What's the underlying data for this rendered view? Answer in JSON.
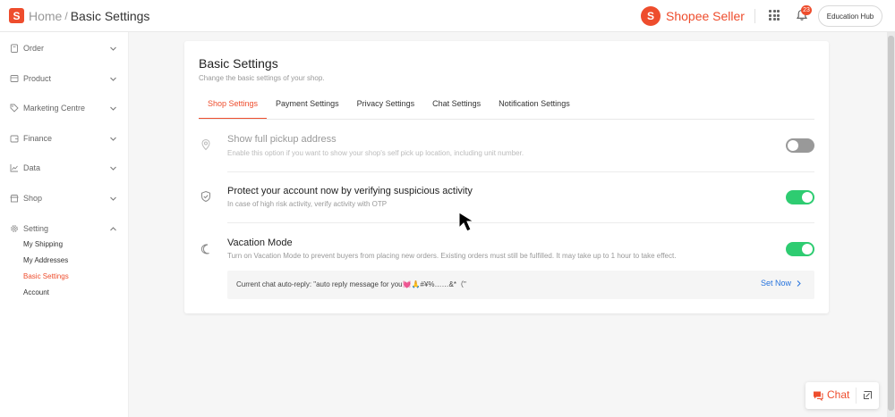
{
  "header": {
    "logo_letter": "S",
    "breadcrumb_home": "Home",
    "breadcrumb_sep": "/",
    "breadcrumb_current": "Basic Settings",
    "brand_name": "Shopee Seller",
    "notification_count": "23",
    "education_hub": "Education Hub"
  },
  "sidebar": {
    "items": [
      {
        "label": "Order",
        "icon": "clipboard-icon"
      },
      {
        "label": "Product",
        "icon": "box-icon"
      },
      {
        "label": "Marketing Centre",
        "icon": "tag-icon"
      },
      {
        "label": "Finance",
        "icon": "wallet-icon"
      },
      {
        "label": "Data",
        "icon": "chart-icon"
      },
      {
        "label": "Shop",
        "icon": "store-icon"
      },
      {
        "label": "Setting",
        "icon": "gear-icon"
      }
    ],
    "sub_items": [
      {
        "label": "My Shipping",
        "active": false
      },
      {
        "label": "My Addresses",
        "active": false
      },
      {
        "label": "Basic Settings",
        "active": true
      },
      {
        "label": "Account",
        "active": false
      }
    ]
  },
  "main": {
    "title": "Basic Settings",
    "subtitle": "Change the basic settings of your shop.",
    "tabs": [
      {
        "label": "Shop Settings",
        "active": true
      },
      {
        "label": "Payment Settings",
        "active": false
      },
      {
        "label": "Privacy Settings",
        "active": false
      },
      {
        "label": "Chat Settings",
        "active": false
      },
      {
        "label": "Notification Settings",
        "active": false
      }
    ],
    "settings": [
      {
        "title": "Show full pickup address",
        "description": "Enable this option if you want to show your shop's self pick up location, including unit number.",
        "enabled": false,
        "disabled": true,
        "icon": "location-pin-icon"
      },
      {
        "title": "Protect your account now by verifying suspicious activity",
        "description": "In case of high risk activity, verify activity with OTP",
        "enabled": true,
        "disabled": false,
        "icon": "shield-check-icon"
      },
      {
        "title": "Vacation Mode",
        "description": "Turn on Vacation Mode to prevent buyers from placing new orders. Existing orders must still be fulfilled. It may take up to 1 hour to take effect.",
        "enabled": true,
        "disabled": false,
        "icon": "moon-icon"
      }
    ],
    "auto_reply_text": "Current chat auto-reply: \"auto reply message for you💓🙏#¥%……&*（\"",
    "set_now": "Set Now"
  },
  "chat_widget": {
    "label": "Chat"
  },
  "colors": {
    "brand": "#ee4d2d",
    "toggle_on": "#2ecc71",
    "toggle_off": "#999999",
    "link": "#2673dd"
  }
}
